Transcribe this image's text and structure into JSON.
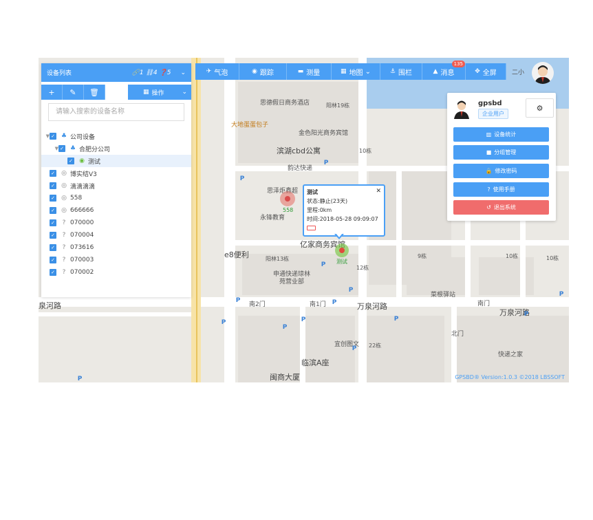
{
  "left_panel": {
    "title": "设备列表",
    "stats": "🔗1 ⛓4 ❓5",
    "search_placeholder": "请输入搜索的设备名称",
    "operate_label": "操作",
    "tree": [
      {
        "label": "公司设备",
        "level": 0,
        "icon": "org-icon"
      },
      {
        "label": "合肥分公司",
        "level": 1,
        "icon": "org-icon"
      },
      {
        "label": "测试",
        "level": 2,
        "icon": "device-online-icon",
        "selected": true
      },
      {
        "label": "博实结V3",
        "level": 0,
        "icon": "device-offline-icon"
      },
      {
        "label": "滴滴滴滴",
        "level": 0,
        "icon": "device-offline-icon"
      },
      {
        "label": "558",
        "level": 0,
        "icon": "device-offline-icon"
      },
      {
        "label": "666666",
        "level": 0,
        "icon": "device-offline-icon"
      },
      {
        "label": "070000",
        "level": 0,
        "icon": "device-unknown-icon"
      },
      {
        "label": "070004",
        "level": 0,
        "icon": "device-unknown-icon"
      },
      {
        "label": "073616",
        "level": 0,
        "icon": "device-unknown-icon"
      },
      {
        "label": "070003",
        "level": 0,
        "icon": "device-unknown-icon"
      },
      {
        "label": "070002",
        "level": 0,
        "icon": "device-unknown-icon"
      }
    ]
  },
  "toolbar": {
    "items": [
      {
        "label": "气泡",
        "icon": "bubble-off-icon"
      },
      {
        "label": "跟踪",
        "icon": "eye-icon"
      },
      {
        "label": "测量",
        "icon": "ruler-icon"
      },
      {
        "label": "地图",
        "icon": "map-icon"
      },
      {
        "label": "围栏",
        "icon": "fence-icon"
      },
      {
        "label": "消息",
        "icon": "bell-icon"
      },
      {
        "label": "全屏",
        "icon": "fullscreen-icon"
      }
    ],
    "message_count": "135"
  },
  "user_panel": {
    "username": "gpsbd",
    "role": "企业用户",
    "buttons": [
      {
        "label": "设备统计",
        "icon": "chart-icon"
      },
      {
        "label": "分组管理",
        "icon": "folder-icon"
      },
      {
        "label": "修改密码",
        "icon": "lock-icon"
      },
      {
        "label": "使用手册",
        "icon": "help-icon"
      },
      {
        "label": "退出系统",
        "icon": "logout-icon"
      }
    ]
  },
  "popup": {
    "title": "测试",
    "status": "状态:静止(23天)",
    "mileage": "里程:0km",
    "time": "时间:2018-05-28 09:09:07"
  },
  "map_labels": {
    "hotel": "思德假日商务酒店",
    "b19": "阳林19栋",
    "restaurant": "大地蛋蛋包子",
    "golden": "金色阳光商务宾馆",
    "cbd": "滨湖cbd公寓",
    "b10": "10栋",
    "yunda": "韵达快递",
    "supermarket": "思泽炬鑫超",
    "edu": "永锋教育",
    "yijia": "亿家商务宾馆",
    "e8": "e8便利",
    "b13": "阳林13栋",
    "express": "申通快递琼林苑营业部",
    "b12": "12栋",
    "b9": "9栋",
    "b10b": "10栋",
    "b10c": "10栋",
    "road_left": "泉河路",
    "road_right": "万泉河路",
    "road_right2": "万泉河路",
    "gate2": "南2门",
    "gate1": "南1门",
    "caigen": "菜根驿站",
    "south_gate": "南门",
    "north_gate": "北门",
    "yishe": "宜创图文",
    "b22": "22栋",
    "linbin": "临滨A座",
    "kuaidi": "快递之家",
    "anhui": "闽商大厦",
    "dev558": "558",
    "devtest": "测试",
    "erxiao": "二小"
  },
  "footer": "GPSBD® Version:1.0.3 ©2018 LBSSOFT"
}
